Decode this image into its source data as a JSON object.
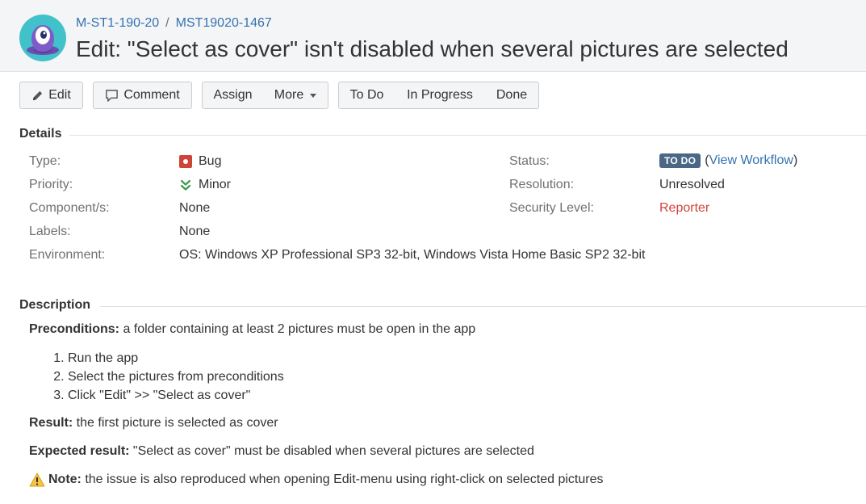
{
  "breadcrumb": {
    "project": "M-ST1-190-20",
    "separator": "/",
    "issue_key": "MST19020-1467"
  },
  "title": "Edit: \"Select as cover\" isn't disabled when several pictures are selected",
  "toolbar": {
    "edit": "Edit",
    "comment": "Comment",
    "assign": "Assign",
    "more": "More",
    "todo": "To Do",
    "in_progress": "In Progress",
    "done": "Done"
  },
  "details": {
    "heading": "Details",
    "left": [
      {
        "label": "Type:",
        "value": "Bug",
        "icon": "bug-icon"
      },
      {
        "label": "Priority:",
        "value": "Minor",
        "icon": "priority-minor-icon"
      },
      {
        "label": "Component/s:",
        "value": "None"
      },
      {
        "label": "Labels:",
        "value": "None"
      },
      {
        "label": "Environment:",
        "value": "OS: Windows XP Professional SP3 32-bit, Windows Vista Home Basic SP2 32-bit"
      }
    ],
    "right": {
      "status_label": "Status:",
      "status_lozenge": "TO DO",
      "view_workflow": "View Workflow",
      "resolution_label": "Resolution:",
      "resolution_value": "Unresolved",
      "security_label": "Security Level:",
      "security_value": "Reporter"
    }
  },
  "description": {
    "heading": "Description",
    "preconditions_label": "Preconditions:",
    "preconditions_text": " a folder containing at least 2 pictures must be open in the app",
    "steps": [
      "Run the app",
      "Select the pictures from preconditions",
      "Click \"Edit\" >> \"Select as cover\""
    ],
    "result_label": "Result:",
    "result_text": " the first picture is selected as cover",
    "expected_label": "Expected result:",
    "expected_text": " \"Select as cover\" must be disabled when several pictures are selected",
    "note_label": "Note:",
    "note_text": " the issue is also reproduced when opening Edit-menu using right-click on selected pictures"
  },
  "colors": {
    "link": "#3572b0",
    "bug": "#d04437",
    "lozenge": "#4a6785",
    "priority_minor": "#3c9a4f",
    "warning": "#f6c342"
  }
}
